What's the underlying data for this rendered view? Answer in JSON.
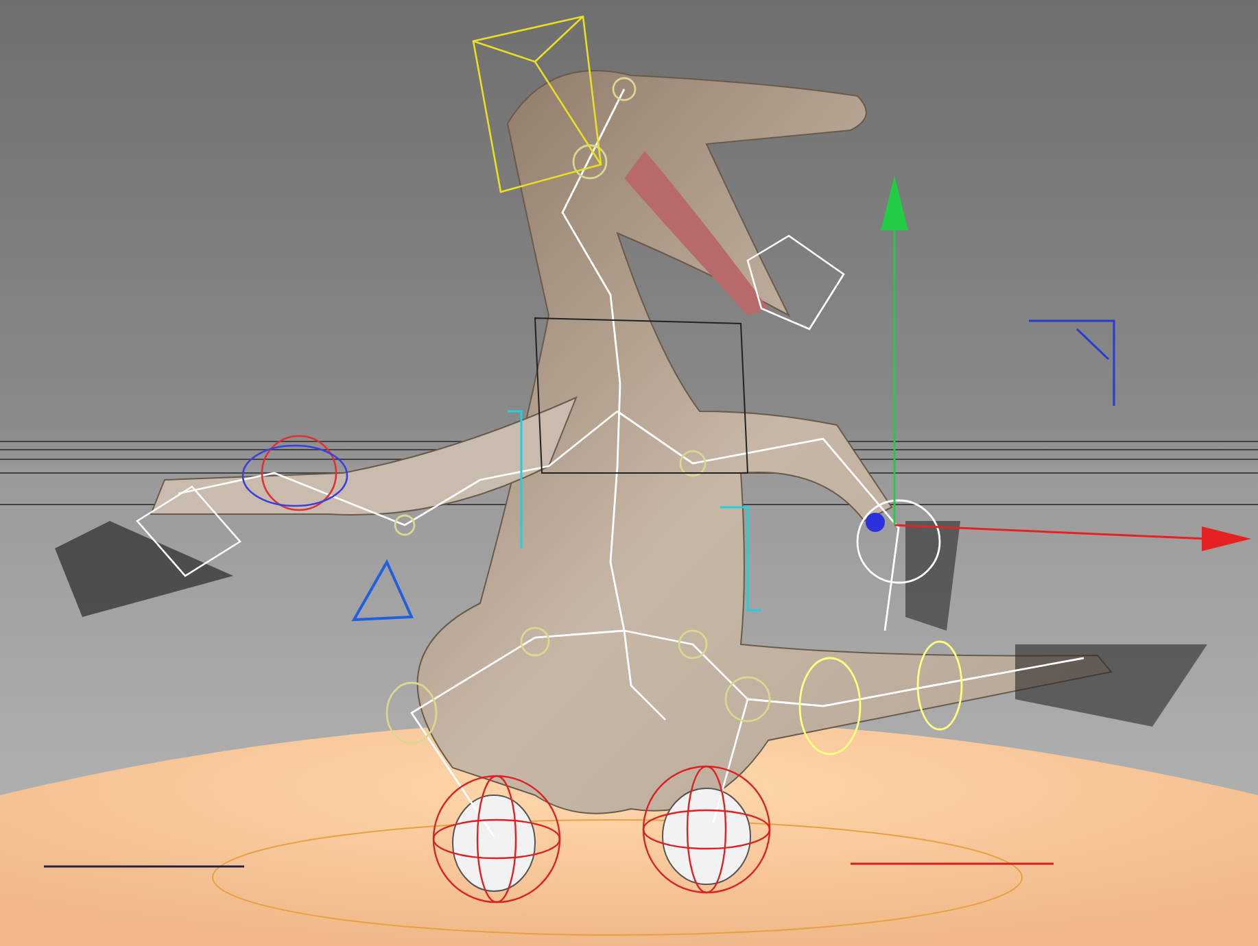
{
  "viewport": {
    "gizmo_arrows": [
      {
        "color": "#e52222"
      },
      {
        "color": "#22cc44"
      }
    ]
  }
}
